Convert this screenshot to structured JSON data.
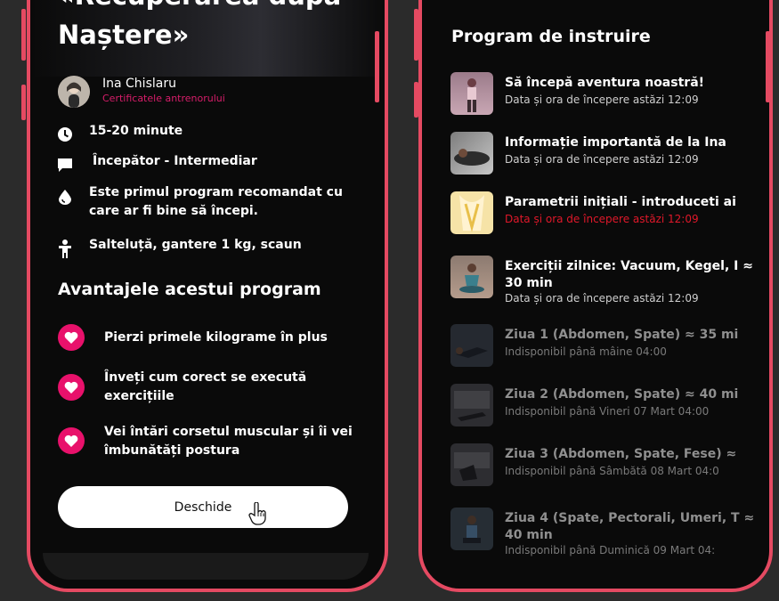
{
  "program": {
    "title_line1": "«Recuperarea după",
    "title_line2": "Naștere»",
    "trainer_name": "Ina Chislaru",
    "trainer_certificates": "Certificatele antrenorului",
    "info": [
      {
        "icon": "clock-icon",
        "text": "15-20 minute"
      },
      {
        "icon": "speech-bubble-icon",
        "text": "Începător - Intermediar"
      },
      {
        "icon": "drop-icon",
        "text": "Este primul program recomandat cu care ar fi bine să începi."
      },
      {
        "icon": "person-icon",
        "text": "Salteluță, gantere 1 kg, scaun"
      }
    ],
    "benefits_title": "Avantajele acestui program",
    "benefits": [
      "Pierzi primele kilograme în plus",
      "Înveți cum corect se execută exercițiile",
      "Vei întări corsetul muscular și îi vei îmbunătăți postura"
    ],
    "open_button_label": "Deschide"
  },
  "training": {
    "title": "Program de instruire",
    "lessons": [
      {
        "title": "Să începă aventura noastră!",
        "subtitle": "Data și ora de începere astăzi 12:09",
        "status": "available"
      },
      {
        "title": "Informație importantă de la Ina",
        "subtitle": "Data și ora de începere astăzi 12:09",
        "status": "available"
      },
      {
        "title": "Parametrii inițiali - introduceti ai",
        "subtitle": "Data și ora de începere astăzi 12:09",
        "status": "due"
      },
      {
        "title": "Exerciții zilnice: Vacuum, Kegel, I ≈ 30 min",
        "subtitle": "Data și ora de începere astăzi 12:09",
        "status": "available"
      },
      {
        "title": "Ziua 1 (Abdomen, Spate) ≈ 35 mi",
        "subtitle": "Indisponibil până mâine 04:00",
        "status": "locked"
      },
      {
        "title": "Ziua 2 (Abdomen, Spate) ≈ 40 mi",
        "subtitle": "Indisponibil până Vineri 07 Mart 04:00",
        "status": "locked"
      },
      {
        "title": "Ziua 3 (Abdomen, Spate, Fese) ≈",
        "subtitle": "Indisponibil până Sâmbătă 08 Mart 04:0",
        "status": "locked"
      },
      {
        "title": "Ziua 4 (Spate, Pectorali, Umeri, T ≈ 40 min",
        "subtitle": "Indisponibil până Duminică 09 Mart 04:",
        "status": "locked"
      }
    ]
  },
  "colors": {
    "frame": "#e54a62",
    "accent_pink": "#e8116b",
    "cert_pink": "#d81d6a",
    "due_red": "#e0182a"
  }
}
